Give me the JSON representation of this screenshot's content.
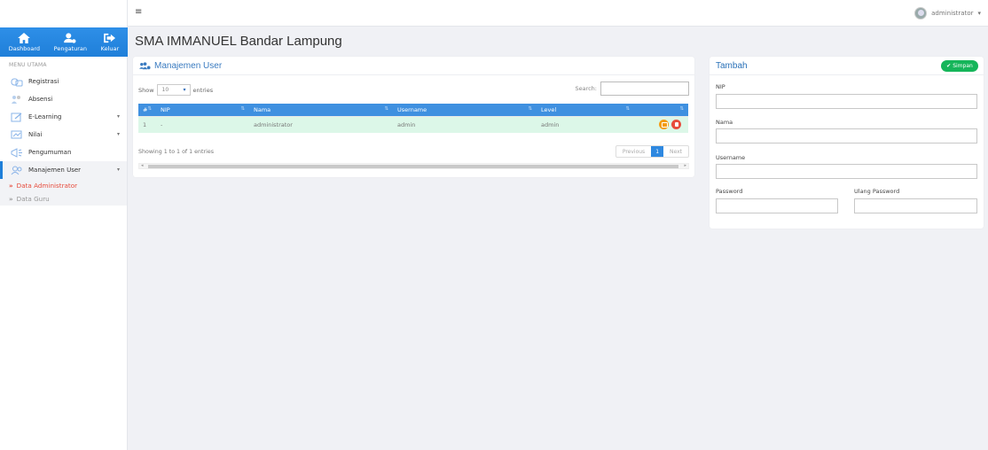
{
  "sidebar": {
    "top_links": [
      {
        "label": "Dashboard",
        "icon": "home-icon"
      },
      {
        "label": "Pengaturan",
        "icon": "users-cog-icon"
      },
      {
        "label": "Keluar",
        "icon": "sign-out-icon"
      }
    ],
    "menu_header": "MENU UTAMA",
    "items": [
      {
        "label": "Registrasi",
        "icon": "registration-icon"
      },
      {
        "label": "Absensi",
        "icon": "attendance-icon"
      },
      {
        "label": "E-Learning",
        "icon": "elearning-icon"
      },
      {
        "label": "Nilai",
        "icon": "grades-icon"
      },
      {
        "label": "Pengumuman",
        "icon": "announcement-icon"
      },
      {
        "label": "Manajemen User",
        "icon": "user-management-icon"
      }
    ],
    "sub_items": [
      {
        "label": "Data Administrator"
      },
      {
        "label": "Data Guru"
      }
    ]
  },
  "topbar": {
    "menu_icon": "≡",
    "user_name": "administrator",
    "user_caret": "▾"
  },
  "page": {
    "title": "SMA IMMANUEL Bandar Lampung"
  },
  "user_table": {
    "title": "Manajemen User",
    "show_label": "Show",
    "entries_value": "10",
    "entries_label": "entries",
    "search_label": "Search:",
    "columns": [
      "#",
      "NIP",
      "Nama",
      "Username",
      "Level",
      ""
    ],
    "rows": [
      {
        "no": "1",
        "nip": "-",
        "nama": "administrator",
        "username": "admin",
        "level": "admin"
      }
    ],
    "info": "Showing 1 to 1 of 1 entries",
    "pager": {
      "previous": "Previous",
      "page": "1",
      "next": "Next"
    }
  },
  "form": {
    "title": "Tambah",
    "save_label": "Simpan",
    "nip_label": "NIP",
    "nama_label": "Nama",
    "username_label": "Username",
    "password_label": "Password",
    "ulang_password_label": "Ulang Password"
  },
  "colors": {
    "primary": "#1f7fd9",
    "table_header": "#3f90e0",
    "row_highlight": "#dcf7e8",
    "save": "#16b55a",
    "active_sub": "#e74c3c"
  }
}
